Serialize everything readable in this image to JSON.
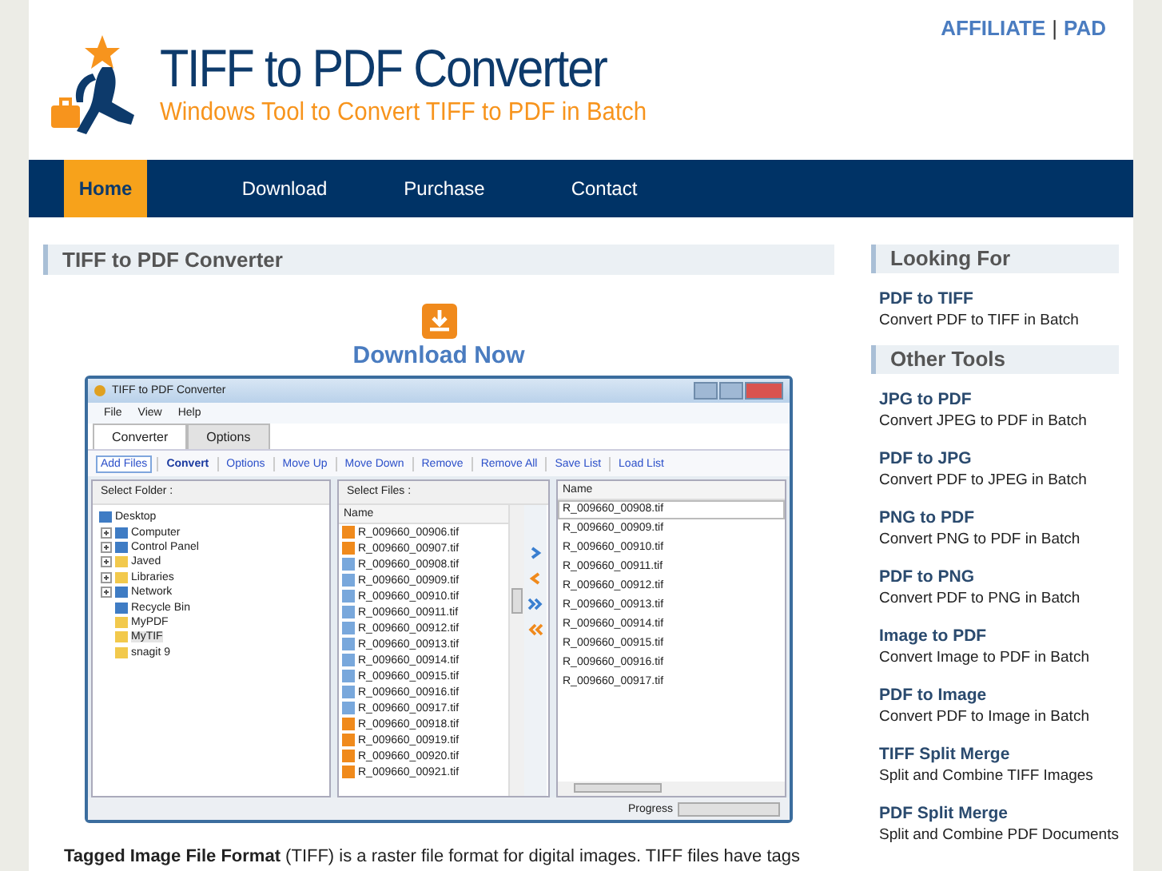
{
  "top_links": {
    "items": [
      {
        "label": "AFFILIATE"
      },
      {
        "label": "PAD"
      }
    ],
    "separator": "|"
  },
  "header": {
    "title": "TIFF to PDF Converter",
    "subtitle": "Windows Tool to Convert TIFF to PDF in Batch"
  },
  "nav": [
    {
      "label": "Home",
      "selected": true
    },
    {
      "label": "Download",
      "selected": false
    },
    {
      "label": "Purchase",
      "selected": false
    },
    {
      "label": "Contact",
      "selected": false
    }
  ],
  "main": {
    "heading": "TIFF to PDF Converter",
    "download_label": "Download Now",
    "app_window": {
      "title": "TIFF to PDF Converter",
      "menu": [
        "File",
        "View",
        "Help"
      ],
      "tabs": [
        {
          "label": "Converter",
          "selected": true
        },
        {
          "label": "Options",
          "selected": false
        }
      ],
      "toolbar": [
        {
          "label": "Add Files",
          "kind": "link",
          "selected": true
        },
        {
          "label": "Convert",
          "kind": "primary",
          "selected": false
        },
        {
          "label": "Options",
          "kind": "link",
          "selected": false
        },
        {
          "label": "Move Up",
          "kind": "link",
          "selected": false
        },
        {
          "label": "Move Down",
          "kind": "link",
          "selected": false
        },
        {
          "label": "Remove",
          "kind": "link",
          "selected": false
        },
        {
          "label": "Remove All",
          "kind": "link",
          "selected": false
        },
        {
          "label": "Save List",
          "kind": "link",
          "selected": false
        },
        {
          "label": "Load List",
          "kind": "link",
          "selected": false
        }
      ],
      "folder_panel": {
        "heading": "Select Folder :",
        "tree": [
          {
            "label": "Desktop",
            "kind": "system",
            "selected": false,
            "children": [
              {
                "label": "Computer",
                "kind": "system",
                "expandable": true,
                "selected": false
              },
              {
                "label": "Control Panel",
                "kind": "system",
                "expandable": true,
                "selected": false
              },
              {
                "label": "Javed",
                "kind": "folder",
                "expandable": true,
                "selected": false
              },
              {
                "label": "Libraries",
                "kind": "folder",
                "expandable": true,
                "selected": false
              },
              {
                "label": "Network",
                "kind": "system",
                "expandable": true,
                "selected": false
              },
              {
                "label": "Recycle Bin",
                "kind": "system",
                "expandable": false,
                "selected": false
              },
              {
                "label": "MyPDF",
                "kind": "folder",
                "expandable": false,
                "selected": false
              },
              {
                "label": "MyTIF",
                "kind": "folder",
                "expandable": false,
                "selected": true
              },
              {
                "label": "snagit 9",
                "kind": "folder",
                "expandable": false,
                "selected": false
              }
            ]
          }
        ]
      },
      "files_panel": {
        "heading": "Select Files :",
        "column": "Name",
        "files": [
          {
            "name": "R_009660_00906.tif",
            "selected": false
          },
          {
            "name": "R_009660_00907.tif",
            "selected": false
          },
          {
            "name": "R_009660_00908.tif",
            "selected": true
          },
          {
            "name": "R_009660_00909.tif",
            "selected": true
          },
          {
            "name": "R_009660_00910.tif",
            "selected": true
          },
          {
            "name": "R_009660_00911.tif",
            "selected": true
          },
          {
            "name": "R_009660_00912.tif",
            "selected": true
          },
          {
            "name": "R_009660_00913.tif",
            "selected": true
          },
          {
            "name": "R_009660_00914.tif",
            "selected": true
          },
          {
            "name": "R_009660_00915.tif",
            "selected": true
          },
          {
            "name": "R_009660_00916.tif",
            "selected": true
          },
          {
            "name": "R_009660_00917.tif",
            "selected": true
          },
          {
            "name": "R_009660_00918.tif",
            "selected": false
          },
          {
            "name": "R_009660_00919.tif",
            "selected": false
          },
          {
            "name": "R_009660_00920.tif",
            "selected": false
          },
          {
            "name": "R_009660_00921.tif",
            "selected": false
          }
        ]
      },
      "queue_panel": {
        "column": "Name",
        "files": [
          {
            "name": "R_009660_00908.tif",
            "selected": true
          },
          {
            "name": "R_009660_00909.tif",
            "selected": false
          },
          {
            "name": "R_009660_00910.tif",
            "selected": false
          },
          {
            "name": "R_009660_00911.tif",
            "selected": false
          },
          {
            "name": "R_009660_00912.tif",
            "selected": false
          },
          {
            "name": "R_009660_00913.tif",
            "selected": false
          },
          {
            "name": "R_009660_00914.tif",
            "selected": false
          },
          {
            "name": "R_009660_00915.tif",
            "selected": false
          },
          {
            "name": "R_009660_00916.tif",
            "selected": false
          },
          {
            "name": "R_009660_00917.tif",
            "selected": false
          }
        ]
      },
      "status": {
        "label": "Progress",
        "level": 0
      }
    },
    "paragraph": "**Tagged Image File Format** (TIFF) is a raster file format for digital images. TIFF files have tags"
  },
  "sidebar": [
    {
      "heading": "Looking For",
      "items": [
        {
          "title": "PDF to TIFF",
          "desc": "Convert PDF to TIFF in Batch"
        }
      ]
    },
    {
      "heading": "Other Tools",
      "items": [
        {
          "title": "JPG to PDF",
          "desc": "Convert JPEG to PDF in Batch"
        },
        {
          "title": "PDF to JPG",
          "desc": "Convert PDF to JPEG in Batch"
        },
        {
          "title": "PNG to PDF",
          "desc": "Convert PNG to PDF in Batch"
        },
        {
          "title": "PDF to PNG",
          "desc": "Convert PDF to PNG in Batch"
        },
        {
          "title": "Image to PDF",
          "desc": "Convert Image to PDF in Batch"
        },
        {
          "title": "PDF to Image",
          "desc": "Convert PDF to Image in Batch"
        },
        {
          "title": "TIFF Split Merge",
          "desc": "Split and Combine TIFF Images"
        },
        {
          "title": "PDF Split Merge",
          "desc": "Split and Combine PDF Documents"
        }
      ]
    }
  ]
}
